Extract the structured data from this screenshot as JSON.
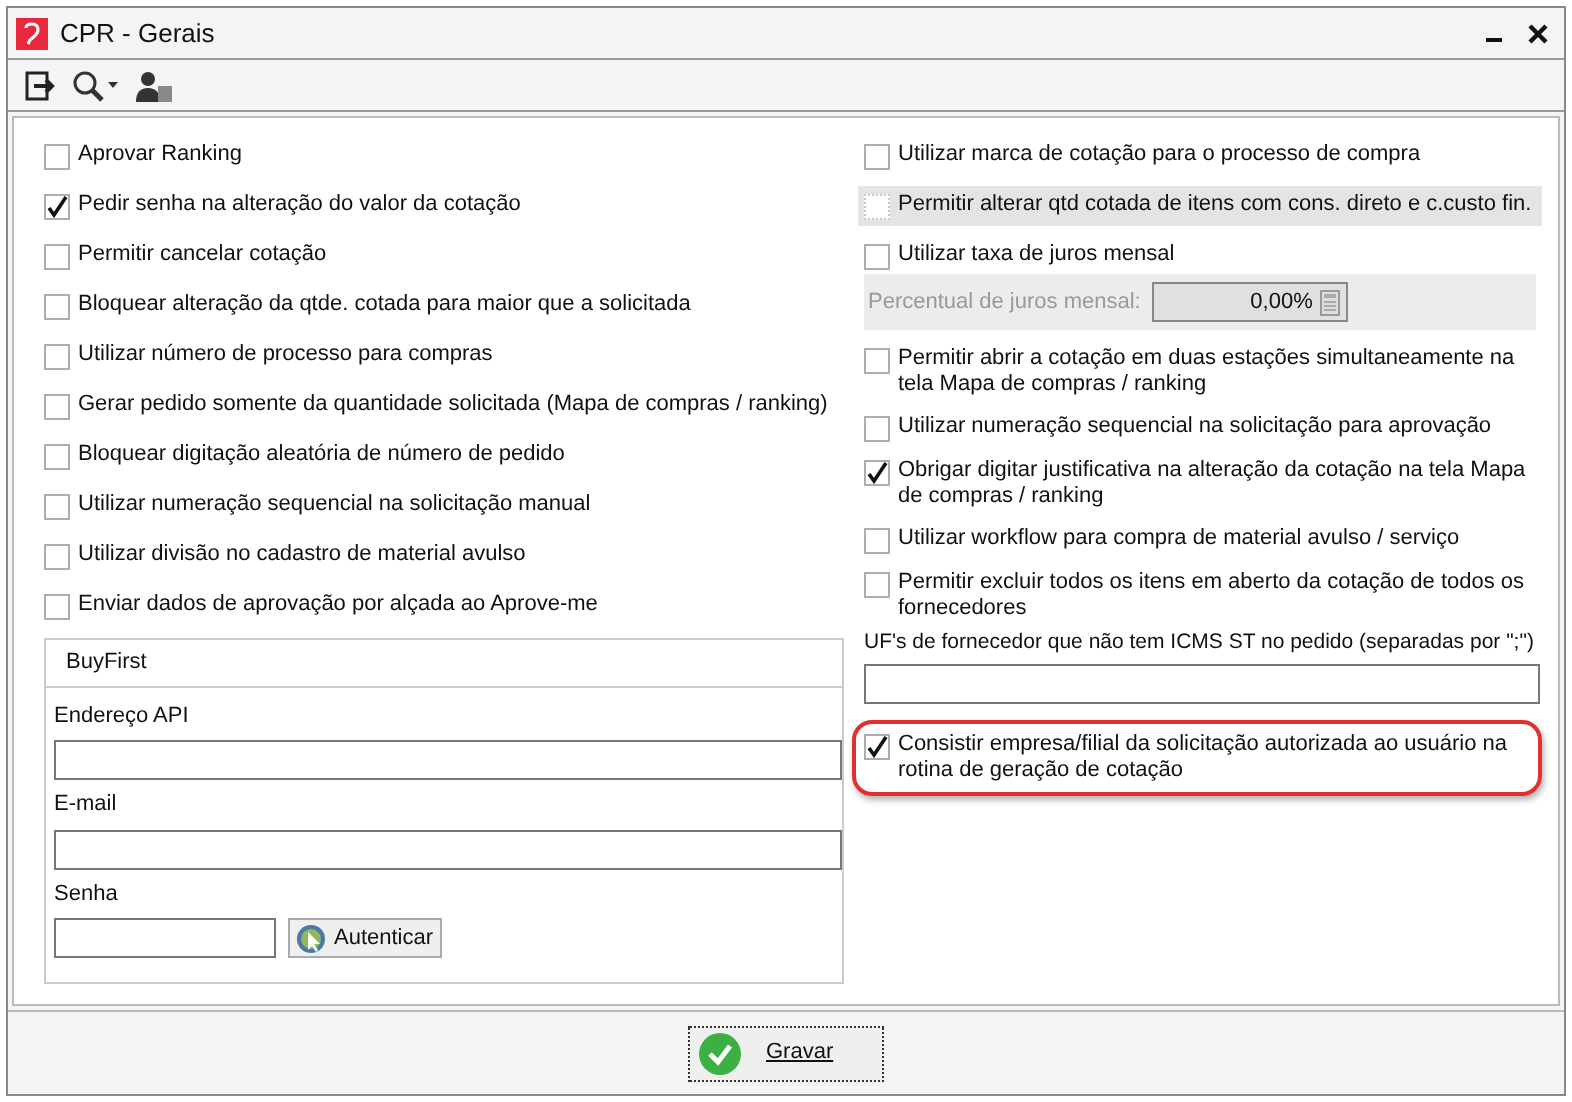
{
  "window": {
    "title": "CPR - Gerais"
  },
  "left_options": [
    {
      "label": "Aprovar Ranking",
      "checked": false
    },
    {
      "label": "Pedir senha na alteração do valor da cotação",
      "checked": true
    },
    {
      "label": "Permitir cancelar cotação",
      "checked": false
    },
    {
      "label": "Bloquear alteração da qtde. cotada para maior que a  solicitada",
      "checked": false
    },
    {
      "label": "Utilizar número de processo para compras",
      "checked": false
    },
    {
      "label": "Gerar pedido somente da quantidade solicitada (Mapa de compras / ranking)",
      "checked": false
    },
    {
      "label": "Bloquear digitação aleatória de número de pedido",
      "checked": false
    },
    {
      "label": "Utilizar numeração sequencial na solicitação manual",
      "checked": false
    },
    {
      "label": "Utilizar divisão no cadastro de material avulso",
      "checked": false
    },
    {
      "label": "Enviar dados de aprovação por alçada ao Aprove-me",
      "checked": false
    }
  ],
  "buyfirst": {
    "title": "BuyFirst",
    "fields": [
      {
        "label": "Endereço API",
        "kind": "wide"
      },
      {
        "label": "E-mail",
        "kind": "wide"
      },
      {
        "label": "Senha",
        "kind": "short"
      }
    ],
    "button": "Autenticar"
  },
  "right_options": [
    {
      "kind": "checkbox",
      "label": "Utilizar marca de cotação  para o processo de compra",
      "checked": false,
      "focused": false,
      "highlighted": false
    },
    {
      "kind": "checkbox",
      "label": "Permitir alterar qtd cotada de itens com cons. direto e c.custo fin.",
      "checked": false,
      "focused": true,
      "highlighted": false
    },
    {
      "kind": "checkbox",
      "label": "Utilizar taxa de juros mensal",
      "checked": false,
      "focused": false,
      "highlighted": false
    },
    {
      "kind": "percent",
      "label": "Percentual de juros mensal:",
      "value": "0,00%",
      "disabled": true
    },
    {
      "kind": "checkbox",
      "label": "Permitir abrir a cotação em duas estações simultaneamente na tela Mapa de compras / ranking",
      "checked": false,
      "focused": false,
      "highlighted": false
    },
    {
      "kind": "checkbox",
      "label": "Utilizar numeração sequencial na solicitação para aprovação",
      "checked": false,
      "focused": false,
      "highlighted": false
    },
    {
      "kind": "checkbox",
      "label": "Obrigar digitar justificativa na alteração da cotação na tela Mapa de compras / ranking",
      "checked": true,
      "focused": false,
      "highlighted": false
    },
    {
      "kind": "checkbox",
      "label": "Utilizar workflow para compra de material avulso / serviço",
      "checked": false,
      "focused": false,
      "highlighted": false
    },
    {
      "kind": "checkbox",
      "label": "Permitir excluir todos os itens em aberto da cotação de todos os fornecedores",
      "checked": false,
      "focused": false,
      "highlighted": false
    },
    {
      "kind": "text",
      "label": "UF's de fornecedor que não tem ICMS ST no pedido (separadas por \";\")"
    },
    {
      "kind": "checkbox",
      "label": "Consistir empresa/filial da solicitação autorizada ao usuário na rotina de geração de cotação",
      "checked": true,
      "focused": false,
      "highlighted": true
    }
  ],
  "footer": {
    "button": "Gravar"
  }
}
